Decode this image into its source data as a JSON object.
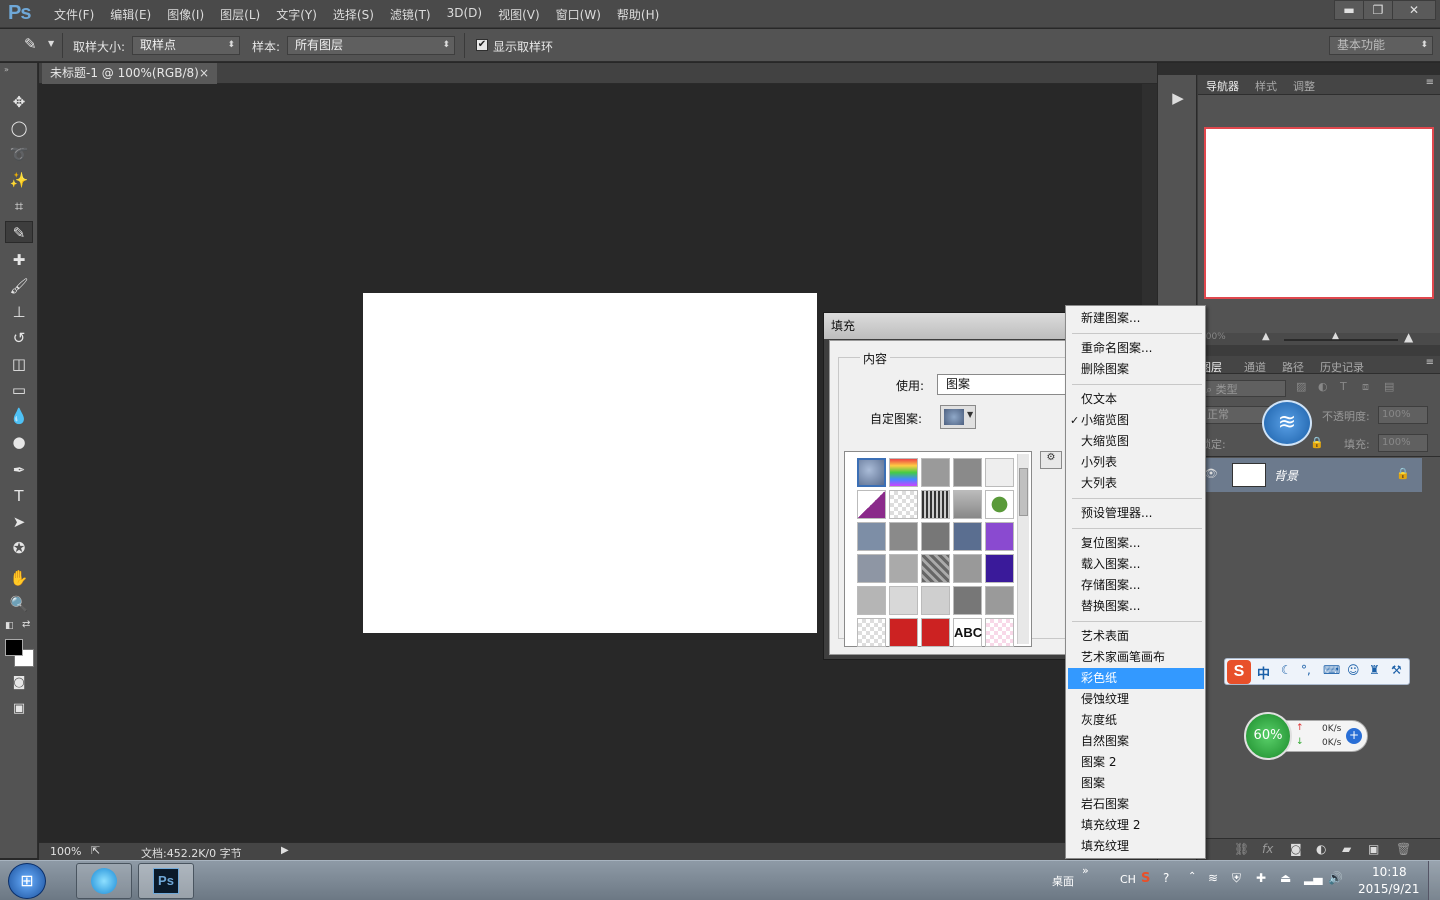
{
  "app": {
    "logo": "Ps"
  },
  "menu": [
    "文件(F)",
    "编辑(E)",
    "图像(I)",
    "图层(L)",
    "文字(Y)",
    "选择(S)",
    "滤镜(T)",
    "3D(D)",
    "视图(V)",
    "窗口(W)",
    "帮助(H)"
  ],
  "window_controls": {
    "minimize": "▬",
    "restore": "❐",
    "close": "✕"
  },
  "options": {
    "sample_size_label": "取样大小:",
    "sample_size_value": "取样点",
    "sample_label": "样本:",
    "sample_value": "所有图层",
    "show_ring_label": "显示取样环",
    "show_ring_checked": "✔",
    "workspace": "基本功能"
  },
  "document": {
    "tab": "未标题-1 @ 100%(RGB/8)",
    "tab_close": "×",
    "zoom": "100%",
    "doc_info": "文档:452.2K/0 字节"
  },
  "panels": {
    "nav_tabs": [
      "导航器",
      "样式",
      "调整"
    ],
    "layers_tabs": [
      "图层",
      "通道",
      "路径",
      "历史记录"
    ],
    "filter_kind": "类型",
    "blend_mode": "正常",
    "opacity_label": "不透明度:",
    "opacity_value": "100%",
    "lock_label": "锁定:",
    "fill_label": "填充:",
    "fill_value": "100%",
    "layer_name": "背景",
    "nav_zoom": "100%"
  },
  "fill_dialog": {
    "title": "填充",
    "content_group": "内容",
    "use_label": "使用:",
    "use_value": "图案",
    "custom_pattern_label": "自定图案:"
  },
  "context_menu": {
    "group1": [
      "新建图案..."
    ],
    "group2": [
      "重命名图案...",
      "删除图案"
    ],
    "group3": [
      "仅文本",
      "小缩览图",
      "大缩览图",
      "小列表",
      "大列表"
    ],
    "checked_mark": "✓",
    "group4": [
      "预设管理器..."
    ],
    "group5": [
      "复位图案...",
      "载入图案...",
      "存储图案...",
      "替换图案..."
    ],
    "group6": [
      "艺术表面",
      "艺术家画笔画布",
      "彩色纸",
      "侵蚀纹理",
      "灰度纸",
      "自然图案",
      "图案 2",
      "图案",
      "岩石图案",
      "填充纹理 2",
      "填充纹理"
    ],
    "highlighted": "彩色纸"
  },
  "overlay": {
    "ime_label": "中",
    "net_percent": "60%",
    "net_up": "0K/s",
    "net_down": "0K/s"
  },
  "taskbar": {
    "desktop_label": "桌面",
    "lang": "CH",
    "time": "10:18",
    "date": "2015/9/21",
    "ps_label": "Ps"
  },
  "colors": {
    "accent": "#3399ff",
    "nav_border": "#e0484e",
    "ps_blue": "#6fa8d8"
  }
}
